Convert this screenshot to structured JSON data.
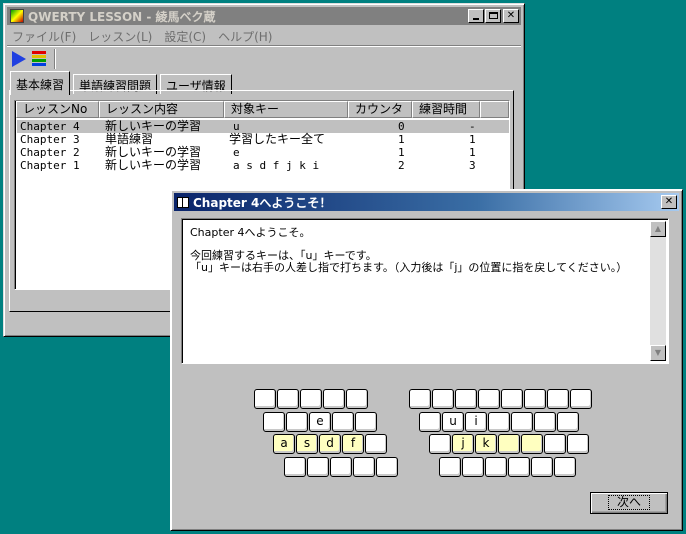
{
  "main_window": {
    "title": "QWERTY LESSON - 綾馬ベク蔵",
    "menu": [
      "ファイル(F)",
      "レッスン(L)",
      "設定(C)",
      "ヘルプ(H)"
    ],
    "tabs": [
      "基本練習",
      "単語練習問題",
      "ユーザ情報"
    ],
    "selected_tab": 0,
    "columns": [
      "レッスンNo",
      "レッスン内容",
      "対象キー",
      "カウンタ",
      "練習時間"
    ],
    "rows": [
      {
        "no": "Chapter 4",
        "content": "新しいキーの学習",
        "keys": "u",
        "counter": "0",
        "time": "-"
      },
      {
        "no": "Chapter 3",
        "content": "単語練習",
        "keys": "学習したキー全て",
        "counter": "1",
        "time": "1"
      },
      {
        "no": "Chapter 2",
        "content": "新しいキーの学習",
        "keys": "e",
        "counter": "1",
        "time": "1"
      },
      {
        "no": "Chapter 1",
        "content": "新しいキーの学習",
        "keys": "a s d f j k i",
        "counter": "2",
        "time": "3"
      }
    ]
  },
  "dialog": {
    "title": "Chapter 4へようこそ！",
    "line1": "Chapter 4へようこそ。",
    "line2": "今回練習するキーは、「u」キーです。",
    "line3": "「u」キーは右手の人差し指で打ちます。（入力後は「j」の位置に指を戻してください。）",
    "next_label": "次へ",
    "left_keys": {
      "row1": [
        "",
        "",
        "",
        "",
        ""
      ],
      "row2": [
        "",
        "",
        "e",
        "",
        ""
      ],
      "row3": [
        "a",
        "s",
        "d",
        "f",
        ""
      ],
      "row4": [
        "",
        "",
        "",
        "",
        ""
      ]
    },
    "right_keys": {
      "row1": [
        "",
        "",
        "",
        "",
        "",
        "",
        "",
        ""
      ],
      "row2": [
        "",
        "u",
        "i",
        "",
        "",
        "",
        ""
      ],
      "row3": [
        "",
        "j",
        "k",
        "",
        "",
        "",
        ""
      ],
      "row4": [
        "",
        "",
        "",
        "",
        "",
        ""
      ]
    },
    "highlight_color": "#ffffc0"
  }
}
